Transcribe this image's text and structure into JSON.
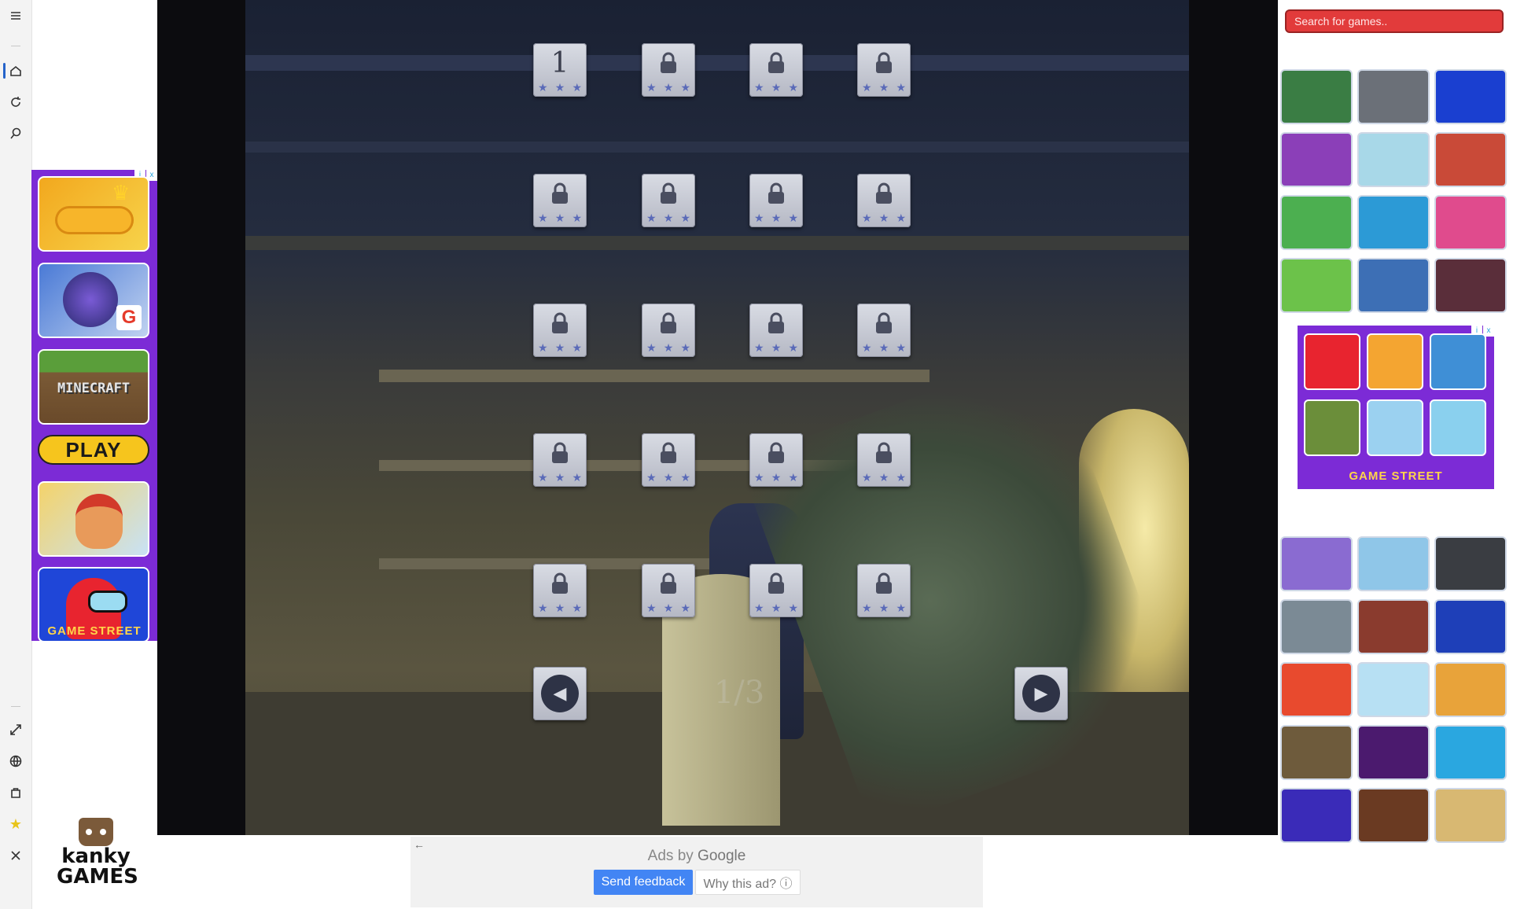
{
  "rail": {
    "icons": [
      "menu-icon",
      "home-icon",
      "refresh-icon",
      "search-icon",
      "fullscreen-icon",
      "globe-icon",
      "bag-icon",
      "star-icon",
      "close-icon"
    ]
  },
  "left_ad": {
    "play_label": "PLAY",
    "brand": "GAME STREET",
    "adchoices": [
      "i",
      "x"
    ],
    "tiles": [
      "Slither io",
      "Garena Free Fire",
      "MINECRAFT",
      "Subway Surfers",
      "Among Us"
    ]
  },
  "logo": {
    "line1": "kanky",
    "line2": "GAMES"
  },
  "game": {
    "levels": [
      {
        "label": "1",
        "locked": false
      },
      {
        "label": "",
        "locked": true
      },
      {
        "label": "",
        "locked": true
      },
      {
        "label": "",
        "locked": true
      },
      {
        "label": "",
        "locked": true
      },
      {
        "label": "",
        "locked": true
      },
      {
        "label": "",
        "locked": true
      },
      {
        "label": "",
        "locked": true
      },
      {
        "label": "",
        "locked": true
      },
      {
        "label": "",
        "locked": true
      },
      {
        "label": "",
        "locked": true
      },
      {
        "label": "",
        "locked": true
      },
      {
        "label": "",
        "locked": true
      },
      {
        "label": "",
        "locked": true
      },
      {
        "label": "",
        "locked": true
      },
      {
        "label": "",
        "locked": true
      },
      {
        "label": "",
        "locked": true
      },
      {
        "label": "",
        "locked": true
      },
      {
        "label": "",
        "locked": true
      },
      {
        "label": "",
        "locked": true
      }
    ],
    "star_glyph": "★",
    "prev_glyph": "◀",
    "next_glyph": "▶",
    "page_indicator": "1/3"
  },
  "ads_bar": {
    "back_glyph": "←",
    "ads_by": "Ads by",
    "google": "Google",
    "send_feedback": "Send feedback",
    "why_this_ad": "Why this ad? ⓘ"
  },
  "sidebar": {
    "search_placeholder": "Search for games..",
    "right_ad_brand": "GAME STREET",
    "right_ad_adchoices": [
      "i",
      "x"
    ],
    "top_thumbs": [
      {
        "name": "garbage-truck-game",
        "color": "#3a7d44"
      },
      {
        "name": "truck-simulator-game",
        "color": "#6b7078"
      },
      {
        "name": "among-us-game",
        "color": "#1a3fd0"
      },
      {
        "name": "magic-match-game",
        "color": "#8b3fb8"
      },
      {
        "name": "samosa-game",
        "color": "#a8d8e8"
      },
      {
        "name": "fire-truck-game",
        "color": "#c94a38"
      },
      {
        "name": "soccer-game",
        "color": "#4caf50"
      },
      {
        "name": "food-truck-game",
        "color": "#2c9ad6"
      },
      {
        "name": "fresh-fruit-game",
        "color": "#e04b8d"
      },
      {
        "name": "candy-match-game",
        "color": "#6cc24a"
      },
      {
        "name": "block-wars-game",
        "color": "#3d6fb5"
      },
      {
        "name": "blocky-horror-game",
        "color": "#5a2e3a"
      }
    ],
    "bottom_thumbs": [
      {
        "name": "van-driver-game",
        "color": "#8a6bd1"
      },
      {
        "name": "bmx-bike-game",
        "color": "#8fc6e8"
      },
      {
        "name": "police-suv-game",
        "color": "#3a3d42"
      },
      {
        "name": "lada-car-game",
        "color": "#7b8a95"
      },
      {
        "name": "old-car-game",
        "color": "#8a3b2e"
      },
      {
        "name": "huggy-wuggy-game",
        "color": "#1e3fb8"
      },
      {
        "name": "angry-bird-game",
        "color": "#e84a2e"
      },
      {
        "name": "pop-it-game",
        "color": "#b7e0f3"
      },
      {
        "name": "kids-game-collection",
        "color": "#e8a33a"
      },
      {
        "name": "runner-game",
        "color": "#6e5b3c"
      },
      {
        "name": "square-adventure-game",
        "color": "#4b1a6e"
      },
      {
        "name": "tennis-masters-game",
        "color": "#2aa7e0"
      },
      {
        "name": "basketball-legends-game",
        "color": "#3a2bb8"
      },
      {
        "name": "basketball-stars-game",
        "color": "#6a3a22"
      },
      {
        "name": "sand-castle-game",
        "color": "#d8b872"
      }
    ],
    "right_ad_tiles": [
      {
        "name": "among-us-ad",
        "color": "#e8242f"
      },
      {
        "name": "candy-crush-ad",
        "color": "#f4a531"
      },
      {
        "name": "pokemon-ad",
        "color": "#3f8fd6"
      },
      {
        "name": "minecraft-ad",
        "color": "#6b8e3a"
      },
      {
        "name": "roblox-ad",
        "color": "#9bd1f0"
      },
      {
        "name": "snow-ad",
        "color": "#8ad0ee"
      }
    ]
  }
}
